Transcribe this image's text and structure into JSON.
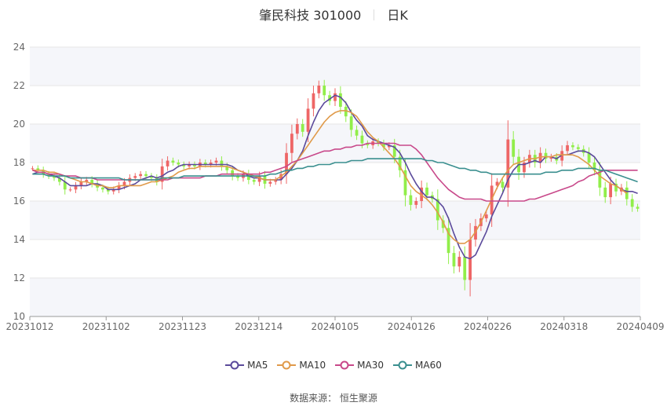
{
  "header": {
    "stock": "肇民科技 301000",
    "period": "日K"
  },
  "source": "数据来源： 恒生聚源",
  "colors": {
    "up": "#ee6666",
    "down": "#91ee4a",
    "grid": "#e6e6e6",
    "band": "#f5f6fa"
  },
  "chart_data": {
    "type": "candlestick",
    "ylim": [
      10,
      24
    ],
    "y_ticks": [
      "10",
      "12",
      "14",
      "16",
      "18",
      "20",
      "22",
      "24"
    ],
    "x_ticks": [
      "20231012",
      "20231102",
      "20231123",
      "20231214",
      "20240105",
      "20240126",
      "20240226",
      "20240318",
      "20240409"
    ],
    "legend": [
      {
        "name": "MA5",
        "color": "#5b4a9b"
      },
      {
        "name": "MA10",
        "color": "#e09a4a"
      },
      {
        "name": "MA30",
        "color": "#c8488a"
      },
      {
        "name": "MA60",
        "color": "#3a8f8f"
      }
    ],
    "close": [
      17.7,
      17.6,
      17.4,
      17.3,
      17.2,
      17.0,
      16.6,
      16.6,
      16.8,
      17.0,
      17.1,
      16.9,
      16.7,
      16.6,
      16.5,
      16.6,
      16.8,
      17.0,
      17.2,
      17.3,
      17.4,
      17.3,
      17.2,
      17.0,
      17.8,
      18.1,
      18.0,
      17.9,
      17.8,
      17.9,
      17.8,
      18.0,
      17.9,
      18.0,
      18.1,
      17.8,
      17.6,
      17.3,
      17.2,
      17.4,
      17.1,
      17.0,
      17.3,
      16.9,
      17.0,
      17.1,
      17.4,
      18.5,
      19.5,
      20.0,
      19.6,
      20.8,
      21.6,
      22.0,
      21.5,
      21.2,
      21.6,
      20.9,
      20.4,
      19.7,
      19.4,
      19.0,
      18.9,
      19.1,
      19.0,
      18.8,
      18.9,
      18.3,
      17.6,
      16.3,
      15.8,
      16.0,
      16.7,
      16.3,
      16.1,
      15.0,
      14.6,
      13.3,
      12.6,
      13.1,
      11.9,
      14.0,
      14.7,
      15.1,
      15.3,
      16.8,
      17.0,
      16.7,
      19.2,
      18.3,
      17.5,
      18.0,
      18.4,
      18.0,
      18.5,
      18.2,
      18.3,
      18.1,
      18.6,
      18.9,
      18.8,
      18.7,
      18.5,
      18.0,
      17.6,
      16.7,
      16.2,
      16.9,
      16.5,
      16.7,
      16.1,
      15.7,
      15.6
    ],
    "ma5": [
      17.4,
      17.5,
      17.5,
      17.4,
      17.3,
      17.2,
      17.0,
      16.8,
      16.8,
      16.8,
      16.8,
      16.9,
      16.9,
      16.8,
      16.6,
      16.6,
      16.6,
      16.7,
      16.8,
      16.9,
      17.1,
      17.2,
      17.3,
      17.2,
      17.3,
      17.5,
      17.6,
      17.8,
      17.9,
      17.9,
      17.9,
      17.9,
      17.9,
      17.9,
      17.9,
      17.9,
      17.9,
      17.8,
      17.6,
      17.5,
      17.3,
      17.2,
      17.2,
      17.1,
      17.1,
      17.1,
      17.1,
      17.4,
      17.7,
      18.1,
      18.6,
      19.4,
      20.1,
      20.7,
      21.1,
      21.3,
      21.5,
      21.4,
      21.1,
      20.6,
      20.2,
      19.9,
      19.4,
      19.2,
      19.1,
      19.0,
      18.9,
      18.8,
      18.5,
      18.0,
      17.4,
      16.9,
      16.5,
      16.2,
      16.2,
      16.0,
      15.7,
      15.1,
      14.3,
      13.6,
      13.1,
      13.0,
      13.2,
      13.8,
      14.4,
      15.2,
      15.8,
      16.4,
      17.1,
      17.6,
      17.9,
      17.9,
      18.0,
      18.1,
      18.0,
      18.3,
      18.3,
      18.2,
      18.4,
      18.4,
      18.5,
      18.6,
      18.6,
      18.5,
      18.3,
      17.9,
      17.5,
      17.1,
      16.8,
      16.6,
      16.5,
      16.5,
      16.4
    ],
    "ma10": [
      17.6,
      17.6,
      17.6,
      17.5,
      17.5,
      17.4,
      17.3,
      17.2,
      17.1,
      17.0,
      17.0,
      16.9,
      16.8,
      16.8,
      16.7,
      16.7,
      16.8,
      16.8,
      16.8,
      16.8,
      16.8,
      16.9,
      17.0,
      17.0,
      17.1,
      17.2,
      17.3,
      17.5,
      17.6,
      17.7,
      17.7,
      17.8,
      17.8,
      17.8,
      17.8,
      17.8,
      17.8,
      17.7,
      17.6,
      17.5,
      17.4,
      17.3,
      17.2,
      17.1,
      17.1,
      17.1,
      17.3,
      17.5,
      17.8,
      18.1,
      18.5,
      18.9,
      19.3,
      19.7,
      20.1,
      20.4,
      20.6,
      20.7,
      20.7,
      20.6,
      20.4,
      20.0,
      19.6,
      19.3,
      19.1,
      18.8,
      18.5,
      18.2,
      17.8,
      17.3,
      16.8,
      16.5,
      16.3,
      16.1,
      15.8,
      15.4,
      14.9,
      14.3,
      14.0,
      13.8,
      13.8,
      14.0,
      14.4,
      14.9,
      15.5,
      16.1,
      16.7,
      17.2,
      17.6,
      17.9,
      18.0,
      18.1,
      18.2,
      18.2,
      18.3,
      18.3,
      18.3,
      18.4,
      18.4,
      18.4,
      18.4,
      18.3,
      18.1,
      17.9,
      17.6,
      17.3,
      17.1,
      16.9,
      16.8,
      16.6,
      16.4
    ],
    "ma30": [
      17.6,
      17.5,
      17.5,
      17.4,
      17.4,
      17.4,
      17.3,
      17.3,
      17.3,
      17.2,
      17.2,
      17.2,
      17.1,
      17.1,
      17.1,
      17.1,
      17.1,
      17.1,
      17.1,
      17.1,
      17.1,
      17.1,
      17.1,
      17.1,
      17.1,
      17.1,
      17.2,
      17.2,
      17.2,
      17.2,
      17.2,
      17.2,
      17.3,
      17.3,
      17.3,
      17.4,
      17.4,
      17.4,
      17.4,
      17.4,
      17.4,
      17.4,
      17.4,
      17.5,
      17.5,
      17.6,
      17.7,
      17.8,
      18.0,
      18.1,
      18.2,
      18.3,
      18.4,
      18.5,
      18.6,
      18.6,
      18.7,
      18.7,
      18.8,
      18.8,
      18.9,
      18.9,
      19.0,
      19.0,
      19.0,
      19.0,
      19.0,
      19.0,
      18.9,
      18.9,
      18.9,
      18.7,
      18.4,
      18.0,
      17.6,
      17.2,
      16.9,
      16.6,
      16.4,
      16.2,
      16.1,
      16.1,
      16.1,
      16.1,
      16.0,
      16.0,
      16.0,
      16.0,
      16.0,
      16.0,
      16.0,
      16.0,
      16.1,
      16.1,
      16.2,
      16.3,
      16.4,
      16.5,
      16.6,
      16.7,
      16.8,
      17.0,
      17.1,
      17.3,
      17.4,
      17.5,
      17.6,
      17.6,
      17.6,
      17.6,
      17.6,
      17.6,
      17.6
    ],
    "ma60": [
      17.4,
      17.4,
      17.4,
      17.3,
      17.3,
      17.3,
      17.3,
      17.2,
      17.2,
      17.2,
      17.2,
      17.2,
      17.2,
      17.2,
      17.2,
      17.2,
      17.2,
      17.1,
      17.1,
      17.1,
      17.1,
      17.1,
      17.1,
      17.1,
      17.2,
      17.2,
      17.2,
      17.2,
      17.3,
      17.3,
      17.3,
      17.3,
      17.3,
      17.3,
      17.3,
      17.3,
      17.3,
      17.3,
      17.3,
      17.3,
      17.3,
      17.3,
      17.3,
      17.3,
      17.4,
      17.4,
      17.5,
      17.6,
      17.6,
      17.7,
      17.7,
      17.8,
      17.8,
      17.9,
      17.9,
      17.9,
      18.0,
      18.0,
      18.0,
      18.1,
      18.1,
      18.1,
      18.2,
      18.2,
      18.2,
      18.2,
      18.2,
      18.2,
      18.2,
      18.2,
      18.2,
      18.2,
      18.2,
      18.1,
      18.1,
      18.0,
      18.0,
      17.9,
      17.8,
      17.7,
      17.7,
      17.6,
      17.6,
      17.5,
      17.5,
      17.4,
      17.4,
      17.4,
      17.4,
      17.4,
      17.4,
      17.4,
      17.4,
      17.4,
      17.4,
      17.5,
      17.5,
      17.5,
      17.6,
      17.6,
      17.6,
      17.7,
      17.7,
      17.7,
      17.7,
      17.6,
      17.6,
      17.5,
      17.4,
      17.3,
      17.2,
      17.1,
      17.0
    ]
  }
}
